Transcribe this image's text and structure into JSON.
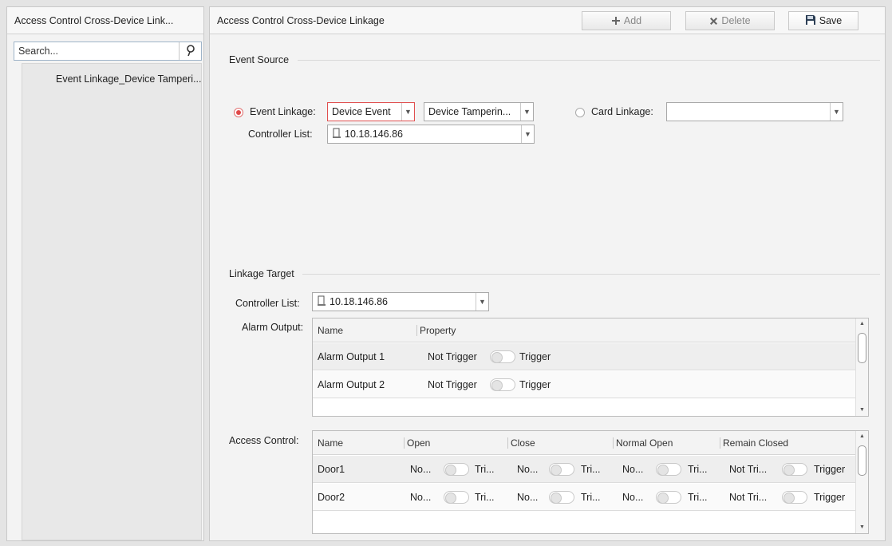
{
  "left_panel": {
    "title": "Access Control Cross-Device Link...",
    "search_placeholder": "Search...",
    "tree_items": [
      "Event Linkage_Device Tamperi..."
    ]
  },
  "right_panel": {
    "title": "Access Control Cross-Device Linkage",
    "toolbar": {
      "add": "Add",
      "delete": "Delete",
      "save": "Save"
    }
  },
  "event_source": {
    "label": "Event Source",
    "event_linkage_label": "Event Linkage:",
    "event_type": "Device Event",
    "event_detail": "Device Tamperin...",
    "card_linkage_label": "Card Linkage:",
    "card_linkage_value": "",
    "controller_label": "Controller List:",
    "controller_value": "10.18.146.86",
    "selected": "event_linkage"
  },
  "linkage_target": {
    "label": "Linkage Target",
    "controller_label": "Controller List:",
    "controller_value": "10.18.146.86",
    "alarm_output_label": "Alarm Output:",
    "alarm_columns": [
      "Name",
      "Property"
    ],
    "alarm_rows": [
      {
        "name": "Alarm Output 1",
        "off": "Not Trigger",
        "on": "Trigger"
      },
      {
        "name": "Alarm Output 2",
        "off": "Not Trigger",
        "on": "Trigger"
      }
    ],
    "access_control_label": "Access Control:",
    "access_columns": [
      "Name",
      "Open",
      "Close",
      "Normal Open",
      "Remain Closed"
    ],
    "access_rows": [
      {
        "name": "Door1",
        "open_off": "No...",
        "open_on": "Tri...",
        "close_off": "No...",
        "close_on": "Tri...",
        "normal_off": "No...",
        "normal_on": "Tri...",
        "remain_off": "Not Tri...",
        "remain_on": "Trigger"
      },
      {
        "name": "Door2",
        "open_off": "No...",
        "open_on": "Tri...",
        "close_off": "No...",
        "close_on": "Tri...",
        "normal_off": "No...",
        "normal_on": "Tri...",
        "remain_off": "Not Tri...",
        "remain_on": "Trigger"
      }
    ]
  },
  "colors": {
    "accent_red": "#e04848",
    "panel_bg": "#f3f3f3",
    "border": "#c9c9c9"
  }
}
